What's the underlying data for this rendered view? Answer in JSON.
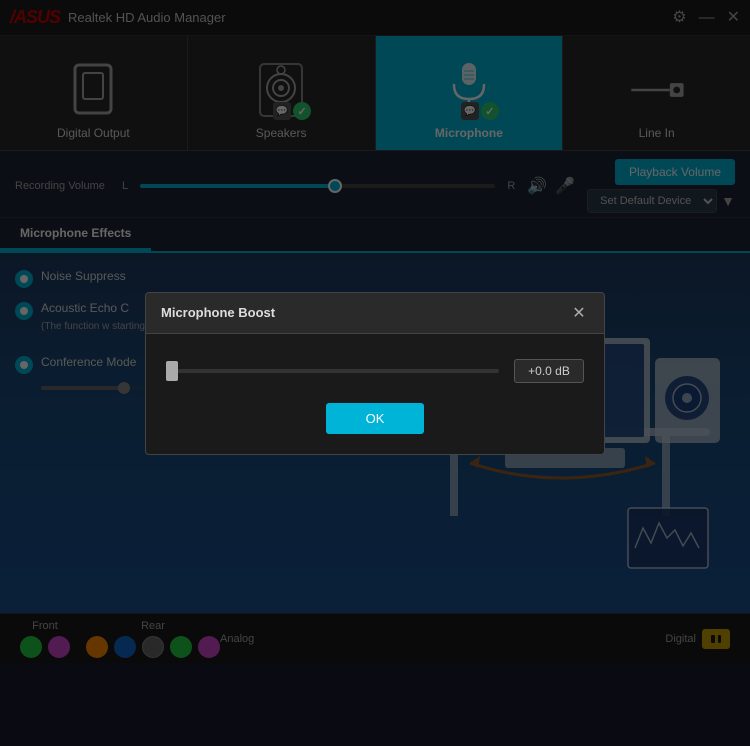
{
  "app": {
    "title": "Realtek HD Audio Manager",
    "logo": "/ASUS"
  },
  "titlebar": {
    "settings_label": "⚙",
    "minimize_label": "—",
    "close_label": "✕"
  },
  "device_tabs": [
    {
      "id": "digital-output",
      "label": "Digital Output",
      "active": false,
      "has_badge": false
    },
    {
      "id": "speakers",
      "label": "Speakers",
      "active": false,
      "has_badge": true
    },
    {
      "id": "microphone",
      "label": "Microphone",
      "active": true,
      "has_badge": true
    },
    {
      "id": "line-in",
      "label": "Line In",
      "active": false,
      "has_badge": false
    }
  ],
  "recording_volume": {
    "label": "Recording Volume",
    "left_label": "L",
    "right_label": "R",
    "fill_percent": 55,
    "thumb_percent": 55
  },
  "playback": {
    "button_label": "Playback Volume",
    "default_device": "Set Default Device"
  },
  "tabs": [
    {
      "id": "microphone-effects",
      "label": "Microphone Effects",
      "active": true
    }
  ],
  "effects": [
    {
      "id": "noise-suppression",
      "label": "Noise Suppress",
      "enabled": true
    },
    {
      "id": "acoustic-echo",
      "label": "Acoustic Echo C",
      "detail": "(The function w\nstarting from t",
      "enabled": true
    },
    {
      "id": "conference-mode",
      "label": "Conference Mode",
      "enabled": true
    }
  ],
  "status_bar": {
    "front_label": "Front",
    "rear_label": "Rear",
    "analog_label": "Analog",
    "digital_label": "Digital",
    "front_dots": [
      {
        "color": "#22cc44"
      },
      {
        "color": "#cc44cc"
      }
    ],
    "rear_dots": [
      {
        "color": "#ff8800"
      },
      {
        "color": "#1166cc"
      },
      {
        "color": "#666666"
      },
      {
        "color": "#22cc44"
      },
      {
        "color": "#cc44cc"
      }
    ]
  },
  "modal": {
    "title": "Microphone Boost",
    "close_label": "✕",
    "db_value": "+0.0 dB",
    "ok_label": "OK",
    "slider_percent": 0
  }
}
